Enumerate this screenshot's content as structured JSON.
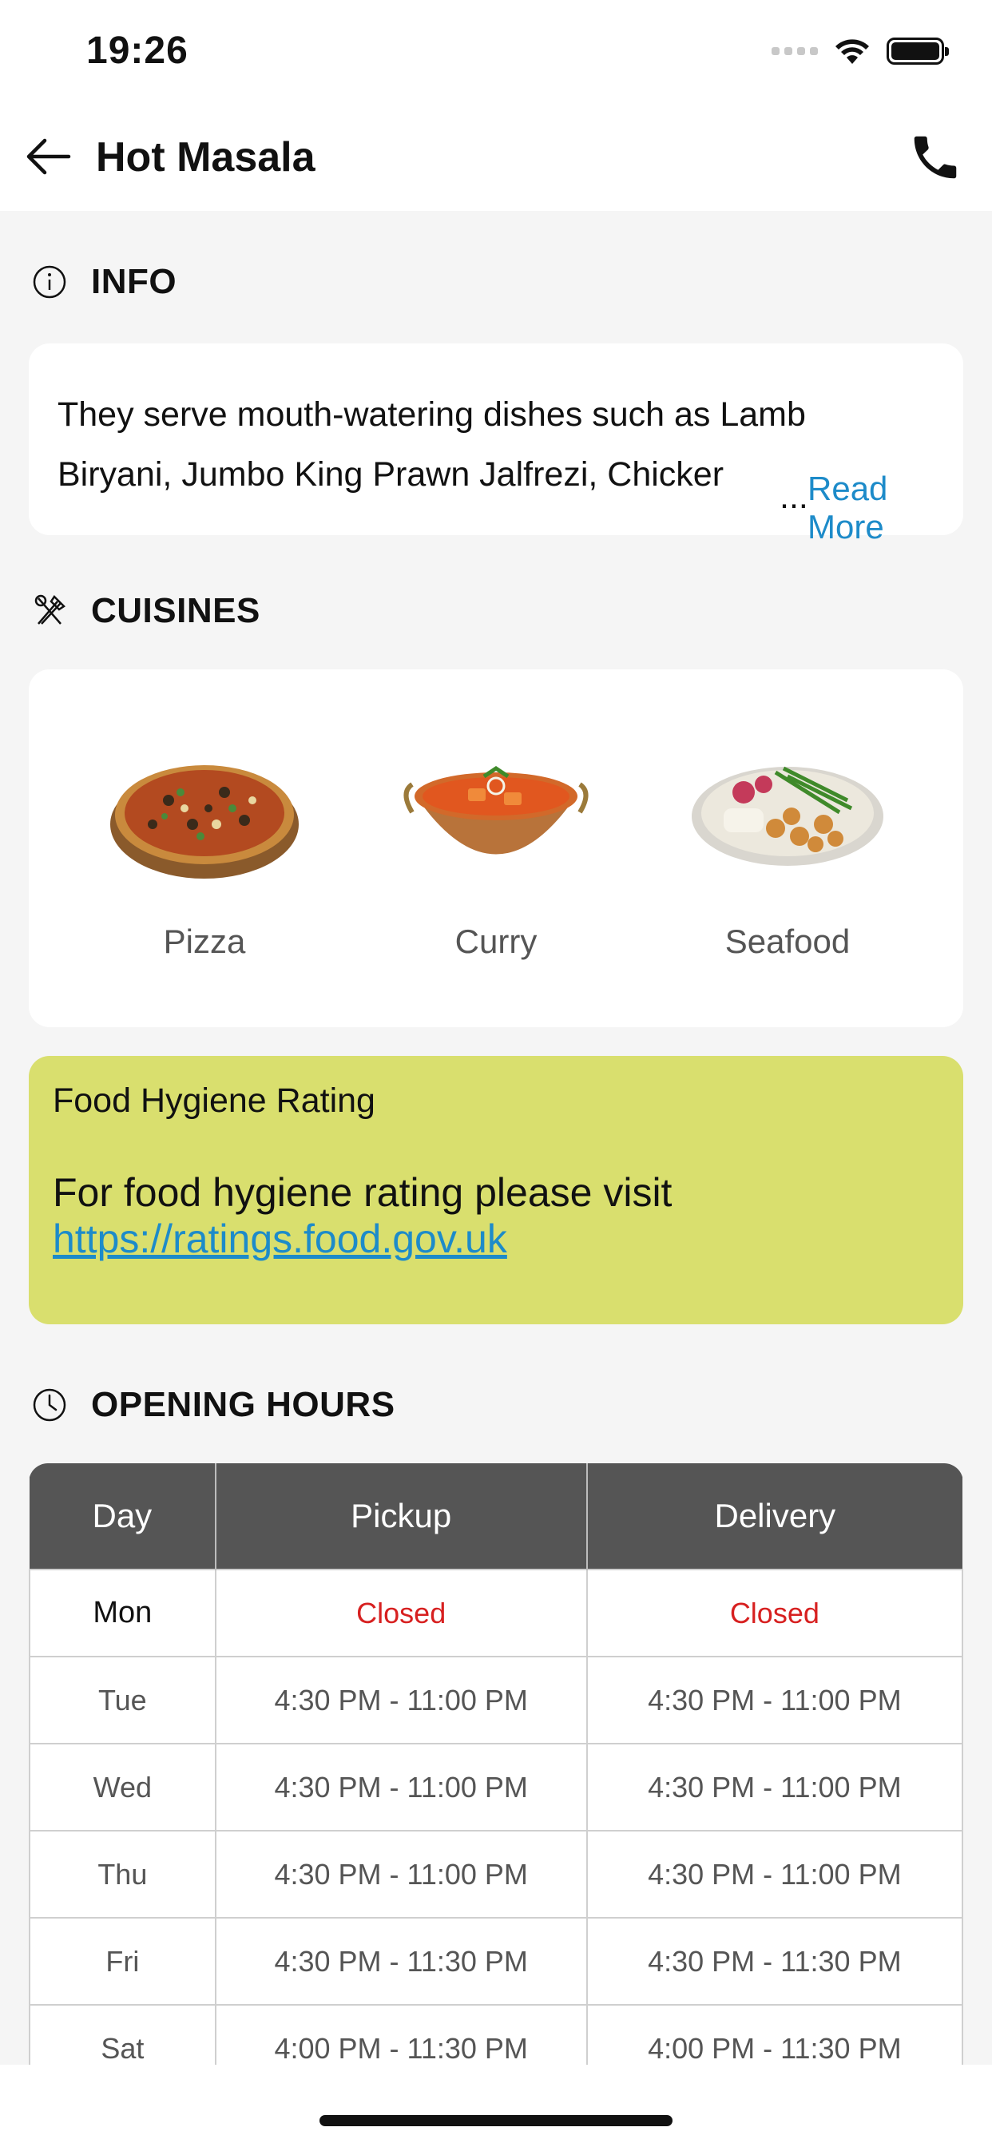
{
  "status_bar": {
    "time": "19:26"
  },
  "header": {
    "title": "Hot Masala"
  },
  "info": {
    "heading": "INFO",
    "line1": "They serve mouth-watering dishes such as Lamb",
    "line2": "Biryani, Jumbo King Prawn Jalfrezi, Chicker",
    "ellipsis": "...",
    "read_more": "Read More"
  },
  "cuisines": {
    "heading": "CUISINES",
    "items": [
      {
        "name": "Pizza"
      },
      {
        "name": "Curry"
      },
      {
        "name": "Seafood"
      }
    ]
  },
  "hygiene": {
    "title": "Food Hygiene Rating",
    "body": "For food hygiene rating please visit",
    "link": "https://ratings.food.gov.uk",
    "background_color": "#d9df6e"
  },
  "opening_hours": {
    "heading": "OPENING HOURS",
    "columns": [
      "Day",
      "Pickup",
      "Delivery"
    ],
    "rows": [
      {
        "day": "Mon",
        "pickup": "Closed",
        "delivery": "Closed"
      },
      {
        "day": "Tue",
        "pickup": "4:30 PM - 11:00 PM",
        "delivery": "4:30 PM - 11:00 PM"
      },
      {
        "day": "Wed",
        "pickup": "4:30 PM - 11:00 PM",
        "delivery": "4:30 PM - 11:00 PM"
      },
      {
        "day": "Thu",
        "pickup": "4:30 PM - 11:00 PM",
        "delivery": "4:30 PM - 11:00 PM"
      },
      {
        "day": "Fri",
        "pickup": "4:30 PM - 11:30 PM",
        "delivery": "4:30 PM - 11:30 PM"
      },
      {
        "day": "Sat",
        "pickup": "4:00 PM - 11:30 PM",
        "delivery": "4:00 PM - 11:30 PM"
      }
    ]
  },
  "colors": {
    "accent_link": "#1d8bc9",
    "closed": "#d72020",
    "table_header": "#555555"
  },
  "icons": {
    "back": "arrow-left-icon",
    "call": "phone-icon",
    "info": "info-circle-icon",
    "cuisines": "utensils-icon",
    "hours": "clock-icon"
  }
}
